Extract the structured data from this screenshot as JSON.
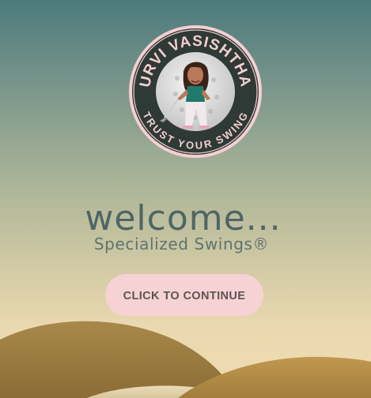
{
  "logo": {
    "name_text": "URVI VASISHTHA",
    "tagline_text": "TRUST YOUR SWING",
    "ring_color": "#f4cfd2",
    "badge_color": "#2f3a36",
    "icon": "golfer-avatar-icon"
  },
  "welcome": {
    "title": "welcome...",
    "subtitle": "Specialized Swings®"
  },
  "cta": {
    "label": "CLICK TO CONTINUE"
  },
  "colors": {
    "button_bg": "#f6d2d4",
    "title_text": "#4e6565",
    "hill_dark": "#9a7a3c",
    "hill_mid": "#b88f45"
  }
}
